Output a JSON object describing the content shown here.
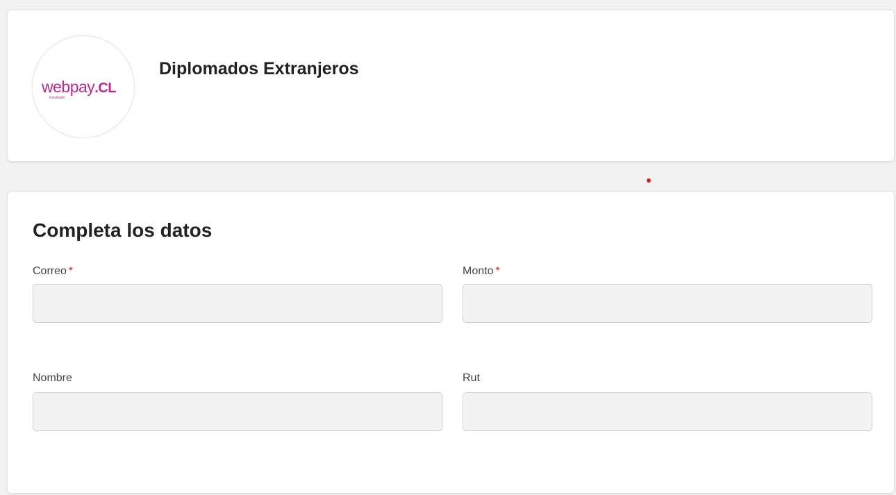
{
  "merchant": {
    "logo_text": "webpay",
    "logo_suffix": ".CL",
    "logo_tagline": "transbank",
    "title": "Diplomados Extranjeros"
  },
  "form": {
    "title": "Completa los datos",
    "fields": [
      {
        "label": "Correo",
        "required": true,
        "value": "",
        "required_mark": "*"
      },
      {
        "label": "Monto",
        "required": true,
        "value": "",
        "required_mark": "*"
      },
      {
        "label": "Nombre",
        "required": false,
        "value": ""
      },
      {
        "label": "Rut",
        "required": false,
        "value": ""
      }
    ]
  },
  "colors": {
    "background": "#f2f2f2",
    "card": "#ffffff",
    "brand": "#c2268d",
    "required": "#e01e1e",
    "input_bg": "#f3f3f3"
  }
}
